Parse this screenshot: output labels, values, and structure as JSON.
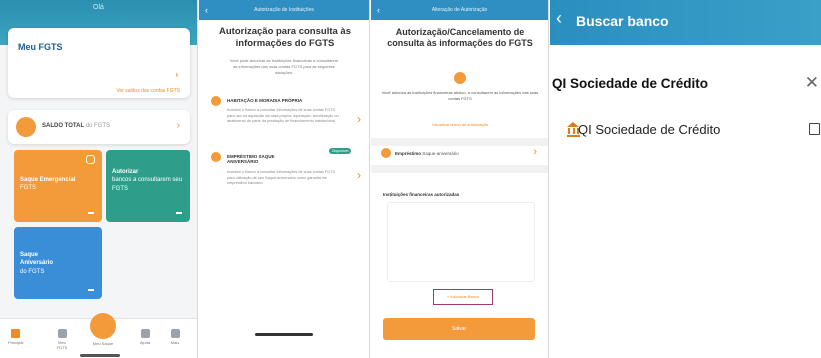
{
  "panel1": {
    "greeting": "Olá",
    "card_title": "Meu FGTS",
    "arrow_label": "›",
    "card_link": "Ver saldos das contas FGTS",
    "saldo_label": "SALDO TOTAL",
    "saldo_suffix": "do FGTS",
    "tiles": [
      {
        "title": "Saque Emergencial",
        "sub": "FGTS"
      },
      {
        "title": "Autorizar",
        "sub": "bancos a consultarem seu FGTS"
      },
      {
        "title": "Saque Aniversário",
        "sub": "do FGTS"
      }
    ],
    "tabs": [
      "Principal",
      "Meu FGTS",
      "Meu Saque",
      "Ajuda",
      "Mais"
    ],
    "colors": {
      "header": "#2b8fb0",
      "orange": "#f39a3a",
      "teal": "#2e9e8a",
      "blue": "#3a8ed8"
    }
  },
  "panel2": {
    "header": "Autorização de Instituições",
    "title": "Autorização para consulta às informações do FGTS",
    "description": "Você pode autorizar as instituições financeiras a consultarem as informações das suas contas FGTS para as seguintes situações:",
    "options": [
      {
        "title": "HABITAÇÃO E MORADIA PRÓPRIA",
        "desc": "Autorize o Banco a consultar informações de suas contas FGTS para uso na aquisição da casa própria, liquidação, amortização ou abatimento de parte da prestação de financiamento habitacional.",
        "badge": ""
      },
      {
        "title": "EMPRÉSTIMO SAQUE ANIVERSÁRIO",
        "desc": "Autorize o Banco a consultar informações de suas contas FGTS para utilização de seu Saque-aniversário como garantia em empréstimo bancário.",
        "badge": "Disponível"
      }
    ]
  },
  "panel3": {
    "header": "Alteração de Autorização",
    "title": "Autorização/Cancelamento de consulta às informações do FGTS",
    "description": "Você autoriza as instituições financeiras abaixo, a consultarem as informações das suas contas FGTS",
    "terms_link": "Visualizar termo de autorização",
    "emprestimo_bold": "Empréstimo",
    "emprestimo_rest": "Saque-aniversário",
    "institutions_title": "Instituições financeiras autorizadas",
    "add_button": "+ Adicionar Banco",
    "submit_button": "Salvar"
  },
  "panel4": {
    "title": "Buscar banco",
    "search_value": "QI Sociedade de Crédito",
    "result_name": "QI Sociedade de Crédito",
    "colors": {
      "header": "#2a8fbf",
      "accent": "#e07b1a"
    }
  }
}
